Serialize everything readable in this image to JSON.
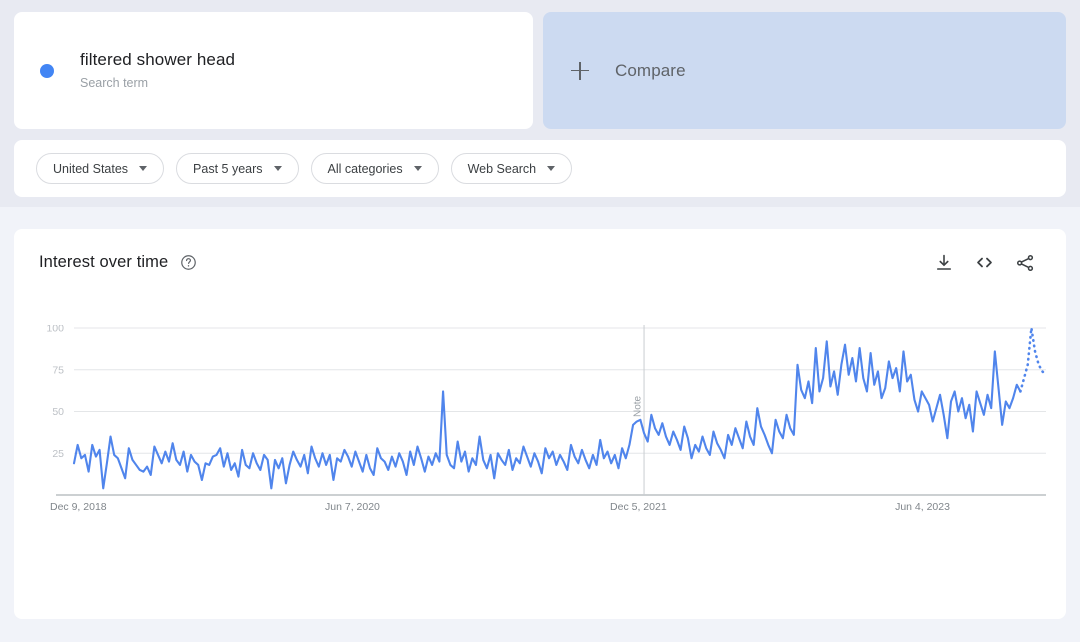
{
  "search_card": {
    "term": "filtered shower head",
    "subtitle": "Search term",
    "dot_color": "#4285f4"
  },
  "compare_card": {
    "label": "Compare",
    "icon": "plus-icon",
    "bg_color": "#ccdaf1"
  },
  "filters": [
    {
      "label": "United States"
    },
    {
      "label": "Past 5 years"
    },
    {
      "label": "All categories"
    },
    {
      "label": "Web Search"
    }
  ],
  "chart_panel": {
    "title": "Interest over time",
    "help_icon": "help-circle-icon",
    "actions": [
      {
        "name": "download-icon"
      },
      {
        "name": "embed-code-icon"
      },
      {
        "name": "share-icon"
      }
    ]
  },
  "chart_data": {
    "type": "line",
    "title": "Interest over time",
    "xlabel": "",
    "ylabel": "",
    "ylim": [
      0,
      100
    ],
    "yticks": [
      25,
      50,
      75,
      100
    ],
    "grid": true,
    "legend": false,
    "line_color": "#5085ec",
    "xticks": [
      "Dec 9, 2018",
      "Jun 7, 2020",
      "Dec 5, 2021",
      "Jun 4, 2023"
    ],
    "xtick_positions": [
      0,
      78,
      156,
      234
    ],
    "annotations": [
      {
        "label": "Note",
        "x_index": 156,
        "type": "vertical-marker"
      }
    ],
    "partial_data_tail": {
      "from_index": 259,
      "note": "dotted segment indicates incomplete period"
    },
    "series": [
      {
        "name": "filtered shower head",
        "values": [
          19,
          30,
          22,
          24,
          14,
          30,
          23,
          27,
          4,
          19,
          35,
          24,
          22,
          16,
          10,
          28,
          21,
          18,
          15,
          14,
          17,
          12,
          29,
          24,
          19,
          26,
          20,
          31,
          21,
          18,
          26,
          14,
          24,
          20,
          18,
          9,
          19,
          18,
          23,
          24,
          28,
          17,
          25,
          15,
          19,
          11,
          27,
          18,
          16,
          25,
          19,
          15,
          24,
          21,
          4,
          21,
          16,
          22,
          7,
          18,
          26,
          21,
          17,
          24,
          13,
          29,
          22,
          17,
          25,
          18,
          24,
          9,
          22,
          20,
          27,
          23,
          17,
          26,
          20,
          14,
          24,
          16,
          12,
          28,
          22,
          20,
          15,
          23,
          17,
          25,
          20,
          12,
          26,
          18,
          29,
          22,
          14,
          23,
          18,
          25,
          20,
          62,
          24,
          18,
          16,
          32,
          20,
          26,
          14,
          22,
          18,
          35,
          21,
          16,
          24,
          10,
          25,
          21,
          18,
          27,
          15,
          22,
          19,
          29,
          23,
          17,
          25,
          20,
          13,
          28,
          22,
          26,
          18,
          24,
          20,
          15,
          30,
          23,
          19,
          27,
          21,
          16,
          24,
          18,
          33,
          22,
          26,
          19,
          24,
          16,
          28,
          22,
          30,
          42,
          44,
          45,
          37,
          32,
          48,
          40,
          36,
          43,
          35,
          30,
          38,
          33,
          27,
          41,
          34,
          22,
          30,
          26,
          35,
          28,
          24,
          38,
          31,
          27,
          22,
          36,
          30,
          40,
          34,
          28,
          44,
          35,
          30,
          52,
          41,
          36,
          30,
          25,
          45,
          38,
          34,
          48,
          40,
          36,
          78,
          63,
          58,
          68,
          55,
          88,
          62,
          70,
          92,
          65,
          74,
          60,
          78,
          90,
          72,
          82,
          68,
          88,
          70,
          62,
          85,
          66,
          74,
          58,
          64,
          80,
          70,
          76,
          62,
          86,
          68,
          72,
          57,
          50,
          62,
          58,
          54,
          44,
          52,
          60,
          48,
          34,
          56,
          62,
          50,
          58,
          46,
          54,
          38,
          62,
          55,
          48,
          60,
          52,
          86,
          64,
          42,
          56,
          52,
          58,
          66,
          62,
          70,
          78,
          100,
          86,
          78,
          74,
          72
        ]
      }
    ]
  }
}
